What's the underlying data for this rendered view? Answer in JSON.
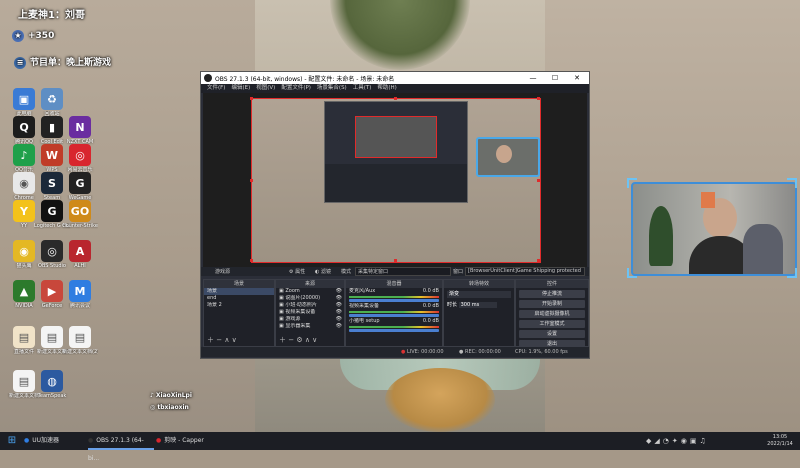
{
  "overlay": {
    "top_label": "上麦神1：刘哥",
    "points": "+350",
    "program_label": "节目单：晚上斯游戏",
    "tiktok_handle": "XiaoXinLpi",
    "weibo_handle": "tbxiaoxin"
  },
  "desktop_icons": [
    {
      "label": "此电脑",
      "color": "#3a7bd5",
      "glyph": "▣"
    },
    {
      "label": "回收站",
      "color": "#5e8ec4",
      "glyph": "♻"
    },
    {
      "label": "腾讯QQ",
      "color": "#1d1d1d",
      "glyph": "Q"
    },
    {
      "label": "Cool Edit",
      "color": "#222",
      "glyph": "▮"
    },
    {
      "label": "NZXT CAM",
      "color": "#6a2ca0",
      "glyph": "N"
    },
    {
      "label": "QQ音乐",
      "color": "#1fa04a",
      "glyph": "♪"
    },
    {
      "label": "WPS",
      "color": "#c03c28",
      "glyph": "W"
    },
    {
      "label": "网易云音乐",
      "color": "#d8262e",
      "glyph": "◎"
    },
    {
      "label": "Chrome",
      "color": "#e8e8e8",
      "glyph": "◉"
    },
    {
      "label": "Steam",
      "color": "#1b2838",
      "glyph": "S"
    },
    {
      "label": "WeGame",
      "color": "#222",
      "glyph": "G"
    },
    {
      "label": "YY",
      "color": "#f3c21b",
      "glyph": "Y"
    },
    {
      "label": "Logitech G HUB",
      "color": "#111",
      "glyph": "G"
    },
    {
      "label": "Counter-Strike",
      "color": "#cf8a1a",
      "glyph": "GO"
    },
    {
      "label": "猫头鹰",
      "color": "#e4b824",
      "glyph": "◉"
    },
    {
      "label": "OBS Studio",
      "color": "#2a2a2a",
      "glyph": "◎"
    },
    {
      "label": "ALHI",
      "color": "#b9262e",
      "glyph": "A"
    },
    {
      "label": "NVIDIA",
      "color": "#2c7a2c",
      "glyph": "▲"
    },
    {
      "label": "GeForce",
      "color": "#c8473b",
      "glyph": "▶"
    },
    {
      "label": "腾讯会议",
      "color": "#2f7de1",
      "glyph": "M"
    },
    {
      "label": "直播文件",
      "color": "#f1e3c8",
      "glyph": "▤"
    },
    {
      "label": "新建文本文档",
      "color": "#f4f4f4",
      "glyph": "▤"
    },
    {
      "label": "新建文本文档(2)",
      "color": "#f4f4f4",
      "glyph": "▤"
    },
    {
      "label": "新建文本文档",
      "color": "#f4f4f4",
      "glyph": "▤"
    },
    {
      "label": "TeamSpeak",
      "color": "#2c5aa0",
      "glyph": "◍"
    }
  ],
  "obs": {
    "title": "OBS 27.1.3 (64-bit, windows) - 配置文件: 未命名 - 场景: 未命名",
    "menu": [
      "文件(F)",
      "编辑(E)",
      "视图(V)",
      "配置文件(P)",
      "场景集合(S)",
      "工具(T)",
      "帮助(H)"
    ],
    "source_toolbar": {
      "source": "游戏源",
      "properties": "属性",
      "filters": "滤镜",
      "mode_label": "模式",
      "mode_value": "采集特定窗口",
      "window_label": "窗口",
      "window_value": "[BrowserUnitClient]Game Shipping protected"
    },
    "scenes_header": "场景",
    "scenes": [
      "场景",
      "end",
      "场景 2"
    ],
    "sources_header": "来源",
    "sources": [
      "Zoom",
      "说图片(20000)",
      "小班·动态照片",
      "视频采集设备",
      "游戏源",
      "显示器采集"
    ],
    "mixer_header": "混音器",
    "mixer": [
      {
        "name": "麦克风/Aux",
        "db": "0.0 dB"
      },
      {
        "name": "视频采集设备",
        "db": "0.0 dB"
      },
      {
        "name": "小猪电 setup",
        "db": "0.0 dB"
      }
    ],
    "transitions_header": "转场特效",
    "transition_value": "渐变",
    "duration_label": "时长",
    "duration_value": "300 ms",
    "controls_header": "控件",
    "controls": [
      "停止推流",
      "开始录制",
      "启动虚拟摄像机",
      "工作室模式",
      "设置",
      "退出"
    ],
    "status": {
      "live": "LIVE: 00:00:00",
      "rec": "REC: 00:00:00",
      "cpu": "CPU: 1.9%, 60.00 fps"
    }
  },
  "taskbar": {
    "start_icon": "windows-icon",
    "items": [
      {
        "label": "UU加速器",
        "active": false
      },
      {
        "label": "OBS 27.1.3 (64-bi...",
        "active": true
      },
      {
        "label": "剪映 - Capper",
        "active": false
      }
    ],
    "clock_time": "13:05",
    "clock_date": "2022/1/14"
  }
}
